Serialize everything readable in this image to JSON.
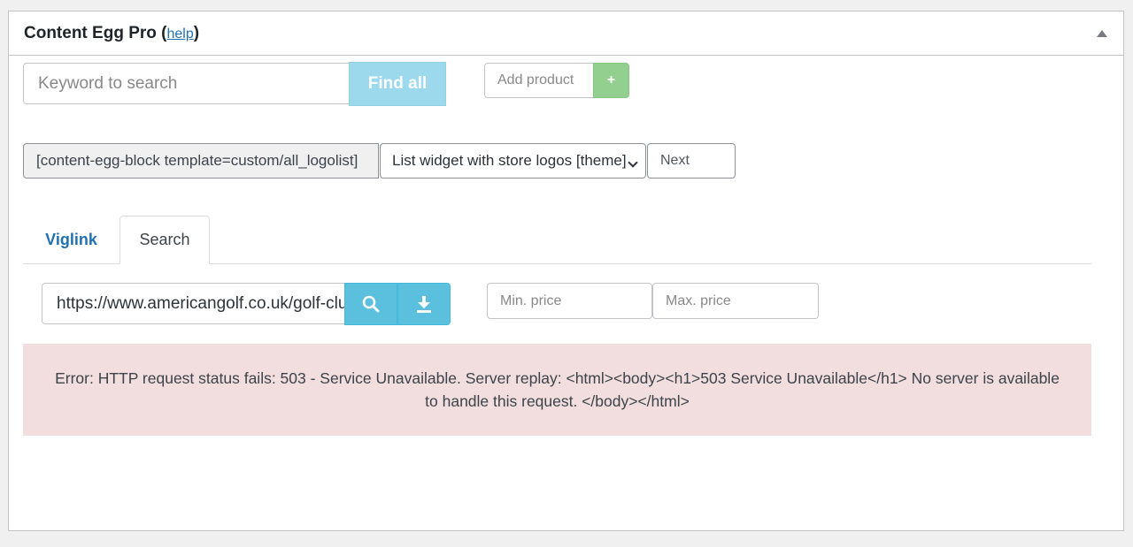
{
  "panel": {
    "title": "Content Egg Pro",
    "help_open": "(",
    "help_label": "help",
    "help_close": ")"
  },
  "search": {
    "keyword_placeholder": "Keyword to search",
    "find_all_label": "Find all",
    "add_product_placeholder": "Add product",
    "add_button_label": "+"
  },
  "block": {
    "shortcode": "[content-egg-block template=custom/all_logolist]",
    "template_selected": "List widget with store logos [theme]",
    "next_placeholder": "Next"
  },
  "tabs": [
    {
      "label": "Viglink",
      "active": false
    },
    {
      "label": "Search",
      "active": true
    }
  ],
  "module": {
    "url_value": "https://www.americangolf.co.uk/golf-clubs",
    "min_price_placeholder": "Min. price",
    "max_price_placeholder": "Max. price"
  },
  "error_message": "Error: HTTP request status fails: 503 - Service Unavailable. Server replay: <html><body><h1>503 Service Unavailable</h1> No server is available to handle this request. </body></html>",
  "icons": {
    "collapse": "triangle-up-icon",
    "search": "magnifier-icon",
    "download": "download-icon"
  },
  "colors": {
    "link": "#2271b1",
    "find_button": "#9dd9ec",
    "add_button": "#93cf8f",
    "action_button": "#5bc0de",
    "error_bg": "#f2dede"
  }
}
